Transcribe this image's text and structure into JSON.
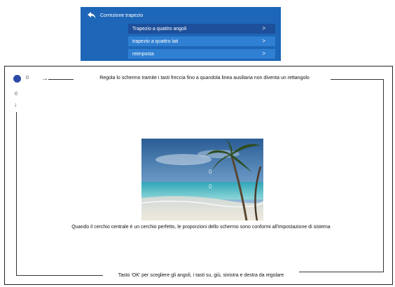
{
  "menu": {
    "title": "Correzione trapezio",
    "items": [
      {
        "label": "Trapezio a quattro angoli",
        "chevron": ">",
        "selected": true
      },
      {
        "label": "trapezio a quattro lati",
        "chevron": ">",
        "selected": false
      },
      {
        "label": "reimposta",
        "chevron": ">",
        "selected": false
      }
    ]
  },
  "screen": {
    "top_value": "0",
    "left_value": "0",
    "instruction_top": "Regola lo schermo tramite i tasti freccia fino a quandola linea ausiliaria non diventa un rettangolo",
    "instruction_middle": "Quando il cerchio centrale è un cerchio perfetto, le proporzioni dello schermo sono conformi all'impostazione di sistema",
    "instruction_bottom": "Tasto 'OK' per scegliere gli angoli, i tasti su, giù, sinistra e destra da regolare",
    "preview_value_1": "0",
    "preview_value_2": "0"
  },
  "colors": {
    "menu_bg": "#1d66b8",
    "menu_item_bg": "#2f7fd2",
    "menu_item_selected_bg": "#1e4f9a",
    "control_dot": "#2c4aa6"
  },
  "icons": {
    "back": "back-arrow-icon",
    "chevron": "chevron-right-icon",
    "arrow": "arrow-right-icon",
    "control": "control-dot-icon"
  }
}
